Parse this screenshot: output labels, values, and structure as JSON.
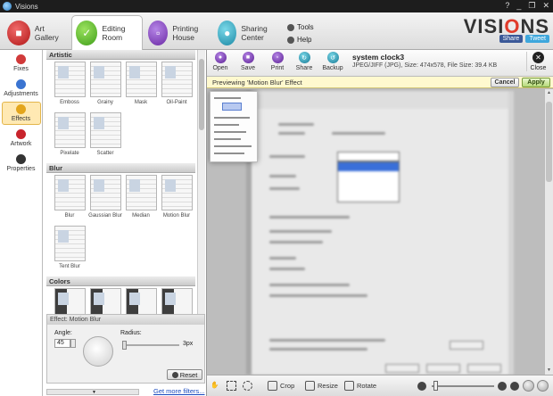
{
  "window": {
    "title": "Visions",
    "controls": [
      "?",
      "_",
      "❐",
      "✕"
    ]
  },
  "tabs": [
    {
      "label": "Art Gallery",
      "icon": "art-gallery-icon"
    },
    {
      "label": "Editing Room",
      "icon": "editing-room-icon"
    },
    {
      "label": "Printing House",
      "icon": "printing-house-icon"
    },
    {
      "label": "Sharing Center",
      "icon": "sharing-center-icon"
    }
  ],
  "header_links": {
    "tools": "Tools",
    "help": "Help"
  },
  "brand": {
    "logo_prefix": "VISI",
    "logo_o": "O",
    "logo_suffix": "NS",
    "share": "Share",
    "tweet": "Tweet",
    "accent": "#e03b2b"
  },
  "leftnav": [
    {
      "label": "Fixes",
      "color": "#d13a3a"
    },
    {
      "label": "Adjustments",
      "color": "#3a74d1"
    },
    {
      "label": "Effects",
      "color": "#e3a51c",
      "selected": true
    },
    {
      "label": "Artwork",
      "color": "#c8242c"
    },
    {
      "label": "Properties",
      "color": "#333333"
    }
  ],
  "sections": {
    "artistic": {
      "title": "Artistic",
      "items": [
        "Emboss",
        "Grainy",
        "Mask",
        "Oil-Paint",
        "Pixelate",
        "Scatter"
      ]
    },
    "blur": {
      "title": "Blur",
      "items": [
        "Blur",
        "Gaussian Blur",
        "Median",
        "Motion Blur",
        "Tent Blur"
      ]
    },
    "colors": {
      "title": "Colors"
    }
  },
  "effect_panel": {
    "title": "Effect: Motion Blur",
    "angle_label": "Angle:",
    "angle_value": "45",
    "radius_label": "Radius:",
    "radius_value": "3px",
    "reset": "Reset"
  },
  "more_filters": "Get more filters...",
  "toolbar": [
    "Open",
    "Save",
    "Print",
    "Share",
    "Backup"
  ],
  "file": {
    "name": "system clock3",
    "details": "JPEG/JIFF (JPG), Size: 474x578, File Size: 39.4 KB"
  },
  "close_label": "Close",
  "preview": {
    "text": "Previewing 'Motion Blur' Effect",
    "cancel": "Cancel",
    "apply": "Apply"
  },
  "bottom": {
    "crop": "Crop",
    "resize": "Resize",
    "rotate": "Rotate"
  }
}
